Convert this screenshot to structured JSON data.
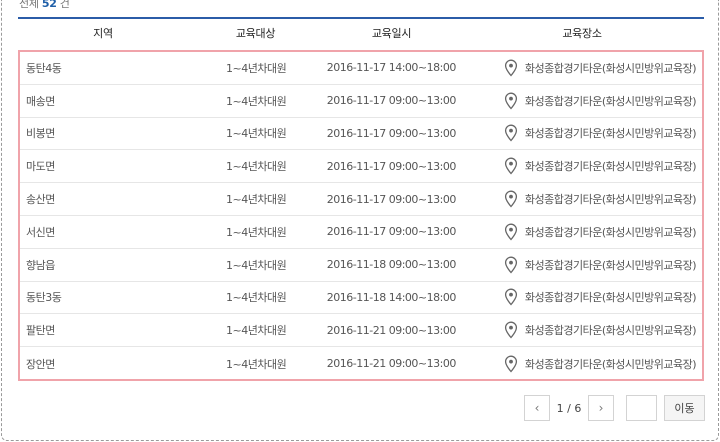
{
  "summary": {
    "prefix": "전체",
    "count": "52",
    "suffix": "건"
  },
  "table": {
    "columns": [
      "지역",
      "교육대상",
      "교육일시",
      "교육장소"
    ],
    "rows": [
      {
        "region": "동탄4동",
        "target": "1~4년차대원",
        "datetime": "2016-11-17 14:00~18:00",
        "place": "화성종합경기타운(화성시민방위교육장)"
      },
      {
        "region": "매송면",
        "target": "1~4년차대원",
        "datetime": "2016-11-17 09:00~13:00",
        "place": "화성종합경기타운(화성시민방위교육장)"
      },
      {
        "region": "비봉면",
        "target": "1~4년차대원",
        "datetime": "2016-11-17 09:00~13:00",
        "place": "화성종합경기타운(화성시민방위교육장)"
      },
      {
        "region": "마도면",
        "target": "1~4년차대원",
        "datetime": "2016-11-17 09:00~13:00",
        "place": "화성종합경기타운(화성시민방위교육장)"
      },
      {
        "region": "송산면",
        "target": "1~4년차대원",
        "datetime": "2016-11-17 09:00~13:00",
        "place": "화성종합경기타운(화성시민방위교육장)"
      },
      {
        "region": "서신면",
        "target": "1~4년차대원",
        "datetime": "2016-11-17 09:00~13:00",
        "place": "화성종합경기타운(화성시민방위교육장)"
      },
      {
        "region": "향남읍",
        "target": "1~4년차대원",
        "datetime": "2016-11-18 09:00~13:00",
        "place": "화성종합경기타운(화성시민방위교육장)"
      },
      {
        "region": "동탄3동",
        "target": "1~4년차대원",
        "datetime": "2016-11-18 14:00~18:00",
        "place": "화성종합경기타운(화성시민방위교육장)"
      },
      {
        "region": "팔탄면",
        "target": "1~4년차대원",
        "datetime": "2016-11-21 09:00~13:00",
        "place": "화성종합경기타운(화성시민방위교육장)"
      },
      {
        "region": "장안면",
        "target": "1~4년차대원",
        "datetime": "2016-11-21 09:00~13:00",
        "place": "화성종합경기타운(화성시민방위교육장)"
      }
    ],
    "place_icon": "map-pin-icon",
    "highlight_color": "#f0a3aa",
    "header_rule_color": "#2b5ca8"
  },
  "pagination": {
    "prev_glyph": "‹",
    "next_glyph": "›",
    "page_info": "1 / 6",
    "goto_value": "",
    "goto_label": "이동"
  }
}
